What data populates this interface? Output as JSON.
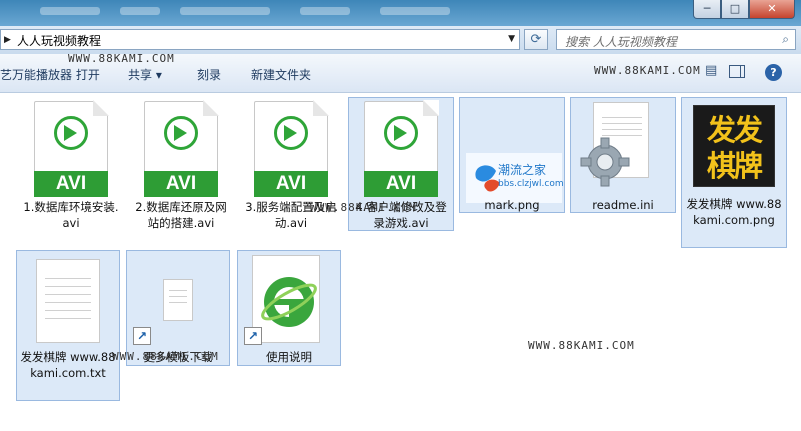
{
  "window": {
    "controls": {
      "minimize": "─",
      "maximize": "□",
      "close": "✕"
    }
  },
  "address": {
    "path": "人人玩视频教程",
    "search_placeholder": "搜索 人人玩视频教程"
  },
  "toolbar": {
    "open_with": "艺万能播放器 打开",
    "share": "共享 ▾",
    "burn": "刻录",
    "new_folder": "新建文件夹",
    "help": "?"
  },
  "watermarks": [
    "WWW.88KAMI.COM",
    "WWW.88KAMI.COM",
    "WWW.88KAMI.COM",
    "WWW.88KAMI.COM",
    "WWW.88KAMI.COM"
  ],
  "files": [
    {
      "name": "1.数据库环境安装.avi",
      "type": "avi",
      "badge": "AVI"
    },
    {
      "name": "2.数据库还原及网站的搭建.avi",
      "type": "avi",
      "badge": "AVI"
    },
    {
      "name": "3.服务端配置及启动.avi",
      "type": "avi",
      "badge": "AVI"
    },
    {
      "name": "4.客户端修改及登录游戏.avi",
      "type": "avi",
      "badge": "AVI"
    },
    {
      "name": "mark.png",
      "type": "png",
      "logo_text": "潮流之家",
      "logo_url": "bbs.clzjwl.com"
    },
    {
      "name": "readme.ini",
      "type": "ini"
    },
    {
      "name": "发发棋牌 www.88kami.com.png",
      "type": "png",
      "logo_text": "发发棋牌"
    },
    {
      "name": "发发棋牌 www.88kami.com.txt",
      "type": "txt"
    },
    {
      "name": "更多模板下载",
      "type": "shortcut"
    },
    {
      "name": "使用说明",
      "type": "shortcut-ie"
    }
  ],
  "icons": {
    "refresh": "refresh-icon",
    "search": "search-icon",
    "shortcut": "shortcut-arrow-icon",
    "gear": "gear-icon",
    "ie": "ie-logo-icon"
  },
  "colors": {
    "avi_green": "#2e9d35",
    "selection": "#dce9f8",
    "qipai_gold": "#f2c21b",
    "ie_green": "#3aa63d"
  }
}
